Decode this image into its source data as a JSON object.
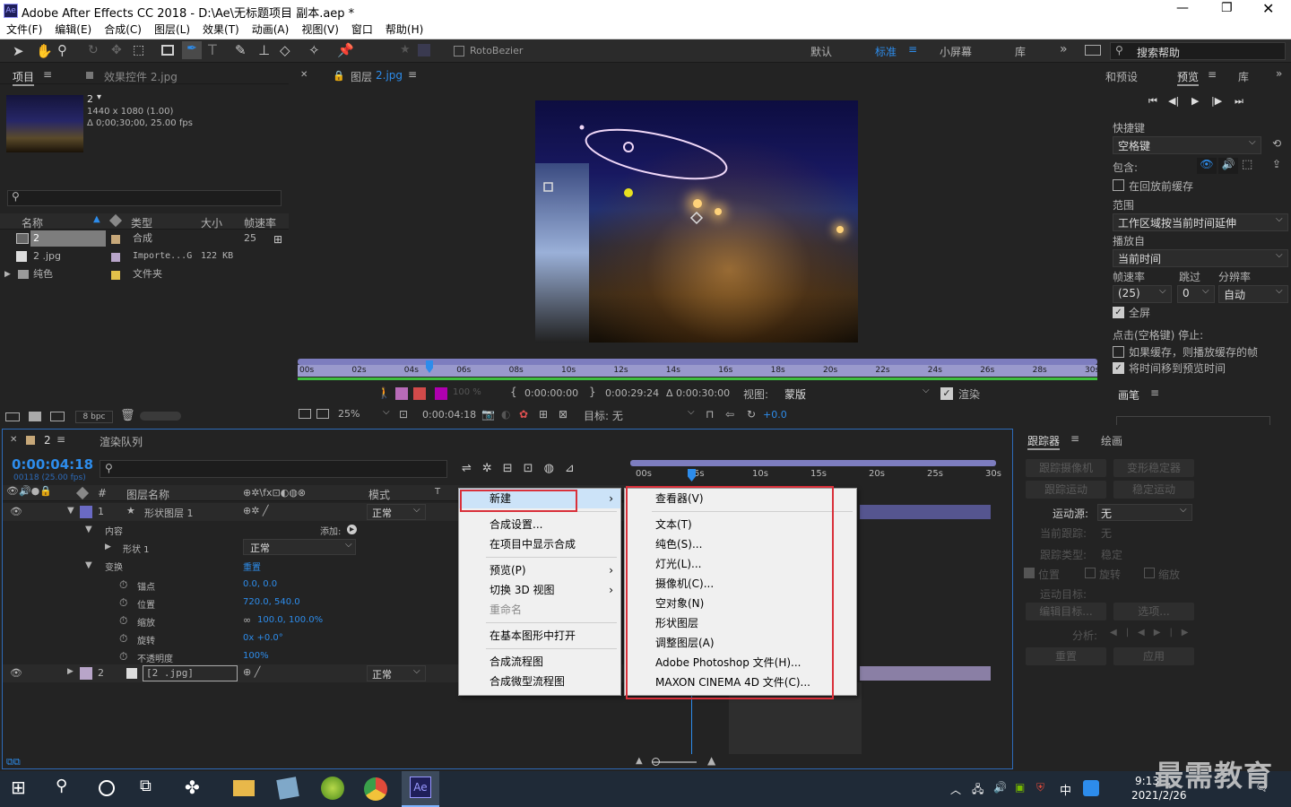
{
  "window": {
    "title": "Adobe After Effects CC 2018 - D:\\Ae\\无标题项目 副本.aep *",
    "app_badge": "Ae"
  },
  "menu": [
    "文件(F)",
    "编辑(E)",
    "合成(C)",
    "图层(L)",
    "效果(T)",
    "动画(A)",
    "视图(V)",
    "窗口",
    "帮助(H)"
  ],
  "toolbar": {
    "rotobezier": "RotoBezier",
    "workspaces": [
      "默认",
      "标准",
      "小屏幕",
      "库"
    ],
    "search_help": "搜索帮助"
  },
  "project": {
    "tab_project": "项目",
    "tab_effects": "效果控件 2.jpg",
    "selected_name": "2",
    "selected_info1": "1440 x 1080 (1.00)",
    "selected_info2": "Δ 0;00;30;00, 25.00 fps",
    "columns": [
      "名称",
      "类型",
      "大小",
      "帧速率"
    ],
    "items": [
      {
        "name": "2",
        "type": "合成",
        "size": "",
        "fps": "25",
        "color": "#c7a879"
      },
      {
        "name": "2 .jpg",
        "type": "Importe...G",
        "size": "122 KB",
        "fps": "",
        "color": "#b8a5c9"
      },
      {
        "name": "纯色",
        "type": "文件夹",
        "size": "",
        "fps": "",
        "color": "#e2c14a"
      }
    ],
    "bpc": "8 bpc"
  },
  "layer_viewer": {
    "tab_label": "图层",
    "tab_name": "2.jpg",
    "ruler": [
      "00s",
      "02s",
      "04s",
      "06s",
      "08s",
      "10s",
      "12s",
      "14s",
      "16s",
      "18s",
      "20s",
      "22s",
      "24s",
      "26s",
      "28s",
      "30s"
    ],
    "tc_in": "0:00:00:00",
    "tc_out": "0:00:29:24",
    "tc_dur": "Δ 0:00:30:00",
    "view_label": "视图:",
    "view_value": "蒙版",
    "render_label": "渲染",
    "zoom": "25%",
    "current_tc": "0:00:04:18",
    "target_label": "目标: 无",
    "exposure": "+0.0",
    "opacity": "100 %"
  },
  "right_panel": {
    "tabs": [
      "和预设",
      "预览",
      "库"
    ],
    "shortcut_label": "快捷键",
    "shortcut_value": "空格键",
    "include_label": "包含:",
    "cache_before": "在回放前缓存",
    "range_label": "范围",
    "range_value": "工作区域按当前时间延伸",
    "play_from_label": "播放自",
    "play_from_value": "当前时间",
    "fps_label": "帧速率",
    "skip_label": "跳过",
    "res_label": "分辨率",
    "fps_value": "(25)",
    "skip_value": "0",
    "res_value": "自动",
    "fullscreen": "全屏",
    "stop_label": "点击(空格键) 停止:",
    "if_cache": "如果缓存，则播放缓存的帧",
    "move_time": "将时间移到预览时间",
    "paint_label": "画笔"
  },
  "timeline": {
    "tab_comp": "2",
    "tab_render": "渲染队列",
    "timecode": "0:00:04:18",
    "frames": "00118 (25.00 fps)",
    "col_name": "图层名称",
    "col_mode": "模式",
    "col_trk": "T",
    "ruler": [
      "00s",
      "5s",
      "10s",
      "15s",
      "20s",
      "25s",
      "30s"
    ],
    "layers": [
      {
        "num": "1",
        "name": "形状图层 1",
        "mode": "正常"
      },
      {
        "num": "2",
        "name": "[2 .jpg]",
        "mode": "正常"
      }
    ],
    "contents_label": "内容",
    "add_label": "添加:",
    "shape_label": "形状 1",
    "shape_mode": "正常",
    "transform_label": "变换",
    "reset_label": "重置",
    "props": [
      {
        "name": "锚点",
        "value": "0.0, 0.0"
      },
      {
        "name": "位置",
        "value": "720.0, 540.0"
      },
      {
        "name": "缩放",
        "value": "100.0, 100.0%"
      },
      {
        "name": "旋转",
        "value": "0x +0.0°"
      },
      {
        "name": "不透明度",
        "value": "100%"
      }
    ]
  },
  "context_menu": {
    "items": [
      {
        "label": "新建",
        "arrow": true,
        "highlight": true
      },
      {
        "sep": true
      },
      {
        "label": "合成设置..."
      },
      {
        "label": "在项目中显示合成"
      },
      {
        "sep": true
      },
      {
        "label": "预览(P)",
        "arrow": true
      },
      {
        "label": "切换 3D 视图",
        "arrow": true
      },
      {
        "label": "重命名",
        "disabled": true
      },
      {
        "sep": true
      },
      {
        "label": "在基本图形中打开"
      },
      {
        "sep": true
      },
      {
        "label": "合成流程图"
      },
      {
        "label": "合成微型流程图"
      }
    ]
  },
  "submenu": {
    "items": [
      {
        "label": "查看器(V)"
      },
      {
        "sep": true
      },
      {
        "label": "文本(T)"
      },
      {
        "label": "纯色(S)..."
      },
      {
        "label": "灯光(L)..."
      },
      {
        "label": "摄像机(C)..."
      },
      {
        "label": "空对象(N)"
      },
      {
        "label": "形状图层"
      },
      {
        "label": "调整图层(A)"
      },
      {
        "label": "Adobe Photoshop 文件(H)..."
      },
      {
        "label": "MAXON CINEMA 4D 文件(C)..."
      }
    ]
  },
  "tracker": {
    "tab_tracker": "跟踪器",
    "tab_paint": "绘画",
    "track_camera": "跟踪摄像机",
    "warp_stab": "变形稳定器",
    "track_motion": "跟踪运动",
    "stab_motion": "稳定运动",
    "motion_source_label": "运动源:",
    "motion_source_value": "无",
    "current_track_label": "当前跟踪:",
    "current_track_value": "无",
    "track_type_label": "跟踪类型:",
    "track_type_value": "稳定",
    "position": "位置",
    "rotation": "旋转",
    "scale": "缩放",
    "motion_target_label": "运动目标:",
    "edit_target": "编辑目标...",
    "options": "选项...",
    "analyze_label": "分析:",
    "reset": "重置",
    "apply": "应用"
  },
  "taskbar": {
    "time": "9:13",
    "date": "2021/2/26",
    "ime": "中",
    "watermark": "最需教育"
  }
}
